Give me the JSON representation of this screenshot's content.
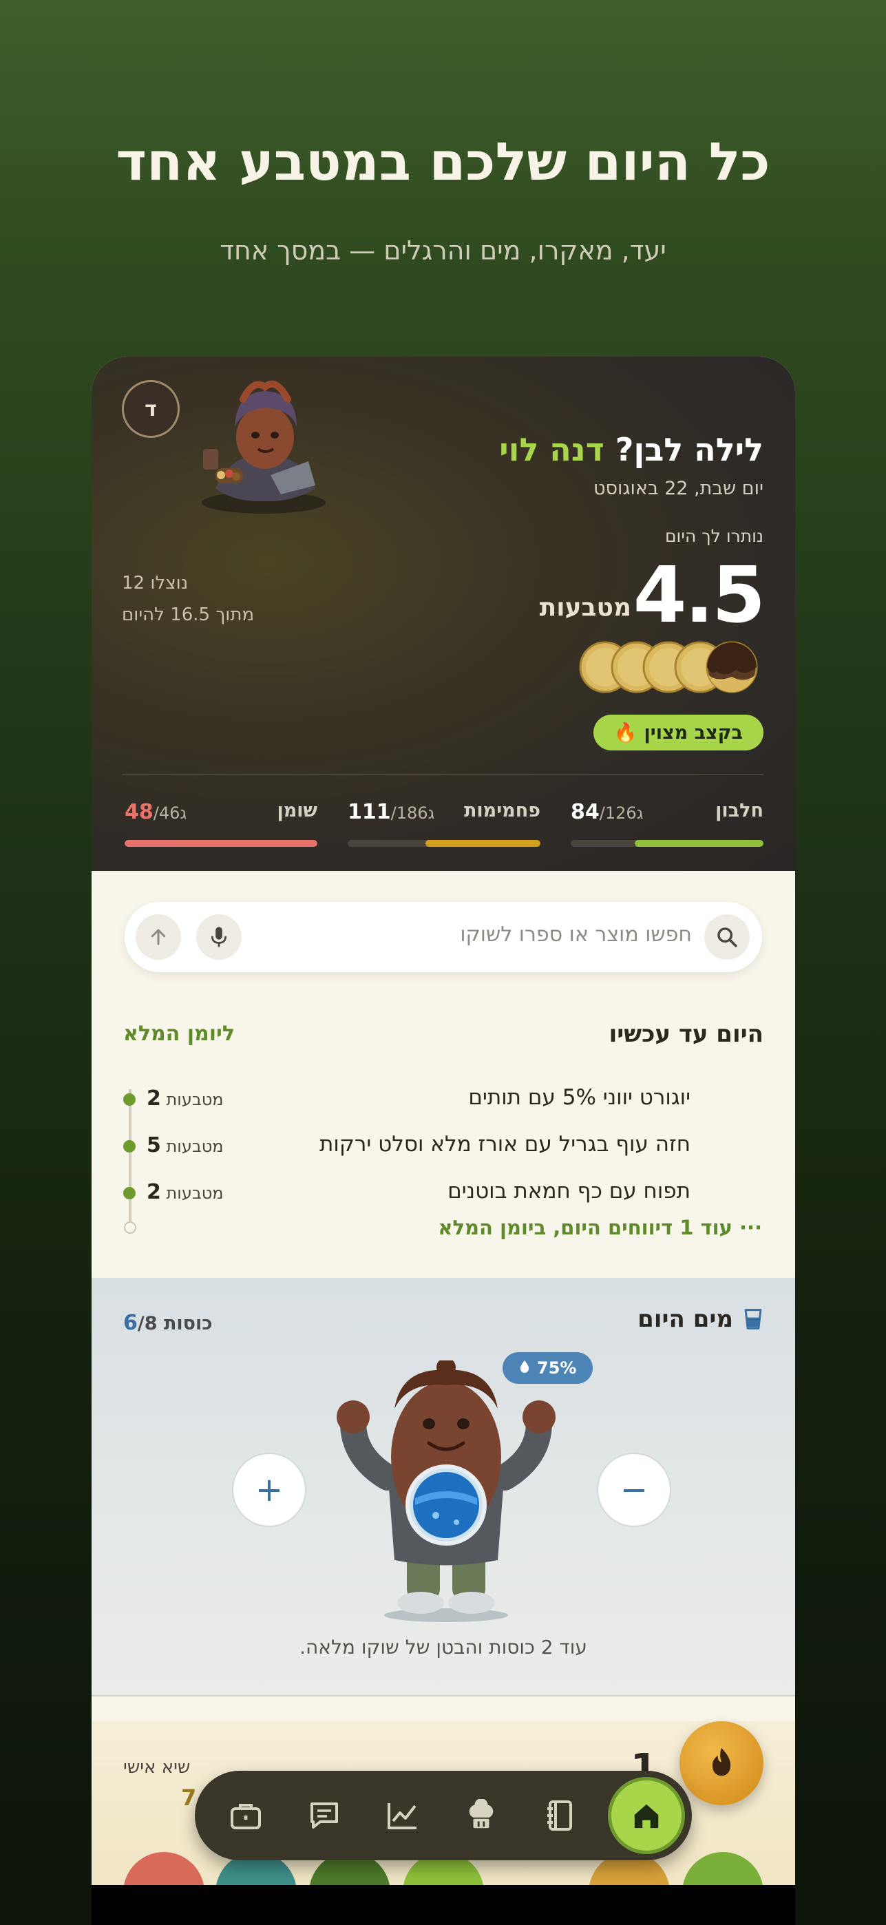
{
  "hero": {
    "title": "כל היום שלכם במטבע אחד",
    "subtitle": "יעד, מאקרו, מים והרגלים — במסך אחד"
  },
  "header": {
    "avatar_letter": "ד",
    "greeting_prefix": "לילה לבן? ",
    "greeting_name": "דנה לוי",
    "date": "יום שבת, 22 באוגוסט",
    "remaining_label": "נותרו לך היום",
    "remaining_value": "4.5",
    "remaining_unit": "מטבעות",
    "saved_line1": "נוצלו 12",
    "saved_line2": "מתוך 16.5 להיום",
    "coins_total": 5,
    "coins_full": 4,
    "streak_badge": "בקצב מצוין",
    "accent": "#a8d64b"
  },
  "macros": [
    {
      "label": "חלבון",
      "current": "84",
      "target": "/126",
      "unit": "ג",
      "fraction": 0.667,
      "color": "#8fc23a"
    },
    {
      "label": "פחמימות",
      "current": "111",
      "target": "/186",
      "unit": "ג",
      "fraction": 0.597,
      "color": "#d4a020"
    },
    {
      "label": "שומן",
      "current": "48",
      "target": "/46",
      "unit": "ג",
      "fraction": 1.0,
      "color": "#e8736a",
      "over": true
    }
  ],
  "search": {
    "placeholder": "חפשו מוצר או ספרו לשוקו"
  },
  "today": {
    "title": "היום עד עכשיו",
    "link": "ליומן המלא",
    "entries": [
      {
        "food": "יוגורט יווני 5% עם תותים",
        "coins": "2",
        "unit": "מטבעות"
      },
      {
        "food": "חזה עוף בגריל עם אורז מלא וסלט ירקות",
        "coins": "5",
        "unit": "מטבעות"
      },
      {
        "food": "תפוח עם כף חמאת בוטנים",
        "coins": "2",
        "unit": "מטבעות"
      }
    ],
    "more": "··· עוד 1 דיווחים היום, ביומן המלא"
  },
  "water": {
    "title": "מים היום",
    "current": "6",
    "target": "/8",
    "unit": "כוסות",
    "percent": "75%",
    "message": "עוד 2 כוסות והבטן של שוקו מלאה.",
    "minus": "−",
    "plus": "+"
  },
  "peek": {
    "label": "שיא אישי",
    "num": "7",
    "big": "1"
  },
  "nav": {
    "items": [
      "briefcase-icon",
      "chat-icon",
      "chart-icon",
      "chef-icon",
      "journal-icon",
      "home-icon"
    ]
  }
}
